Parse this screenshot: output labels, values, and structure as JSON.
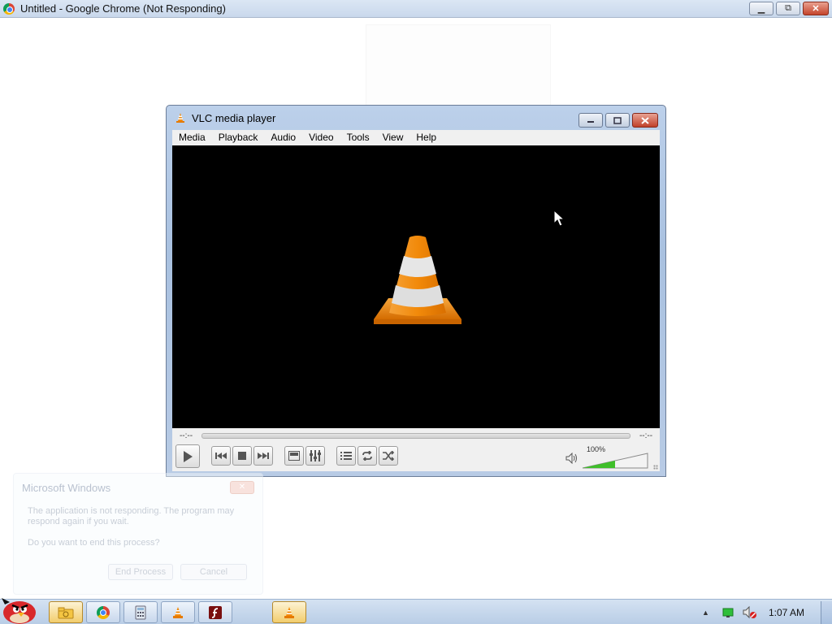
{
  "chrome": {
    "title": "Untitled - Google Chrome (Not Responding)",
    "minimize": "▁",
    "restore": "⧉",
    "close": "✕"
  },
  "vlc": {
    "title": "VLC media player",
    "menu": [
      "Media",
      "Playback",
      "Audio",
      "Video",
      "Tools",
      "View",
      "Help"
    ],
    "elapsed": "--:--",
    "remaining": "--:--",
    "volume_label": "100%",
    "volume_level": 1.0,
    "colors": {
      "cone_orange": "#f28a0a",
      "volume_green": "#3fbf2a"
    }
  },
  "dialog": {
    "title": "Microsoft Windows",
    "message": "The application is not responding. The program may respond again if you wait.",
    "question": "Do you want to end this process?",
    "end_button": "End Process",
    "cancel_button": "Cancel"
  },
  "taskbar": {
    "apps": [
      "angry-birds-start",
      "explorer-folder",
      "google-chrome",
      "calculator",
      "vlc-media-player",
      "adobe-flash",
      "vlc-media-player-active"
    ],
    "clock": "1:07 AM"
  }
}
